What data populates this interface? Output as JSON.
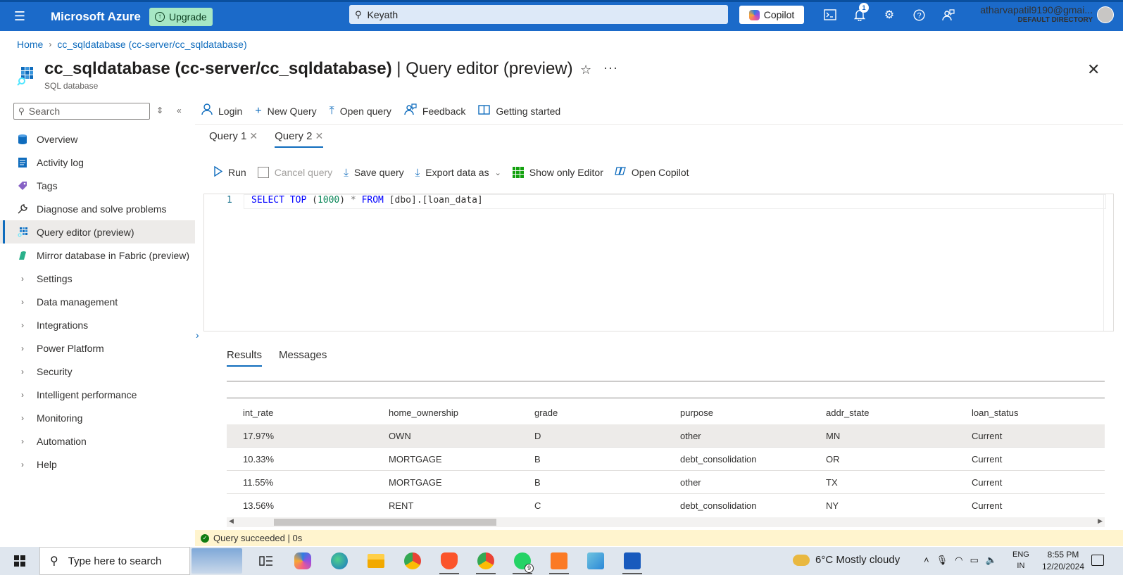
{
  "topbar": {
    "brand": "Microsoft Azure",
    "upgrade_label": "Upgrade",
    "search_value": "Keyath",
    "copilot_label": "Copilot",
    "notification_count": "1",
    "account_email": "atharvapatil9190@gmai...",
    "account_directory": "DEFAULT DIRECTORY"
  },
  "breadcrumb": {
    "home": "Home",
    "current": "cc_sqldatabase (cc-server/cc_sqldatabase)"
  },
  "header": {
    "title_resource": "cc_sqldatabase (cc-server/cc_sqldatabase)",
    "title_separator": " | ",
    "title_blade": "Query editor (preview)",
    "subtitle": "SQL database",
    "star_glyph": "☆",
    "more_glyph": "···",
    "close_glyph": "✕"
  },
  "sidebar": {
    "search_placeholder": "Search",
    "items": [
      {
        "label": "Overview",
        "icon": "sql-icon"
      },
      {
        "label": "Activity log",
        "icon": "activity-log-icon"
      },
      {
        "label": "Tags",
        "icon": "tag-icon"
      },
      {
        "label": "Diagnose and solve problems",
        "icon": "wrench-icon"
      },
      {
        "label": "Query editor (preview)",
        "icon": "query-editor-icon"
      },
      {
        "label": "Mirror database in Fabric (preview)",
        "icon": "fabric-icon"
      },
      {
        "label": "Settings",
        "icon": "chevron-right-icon"
      },
      {
        "label": "Data management",
        "icon": "chevron-right-icon"
      },
      {
        "label": "Integrations",
        "icon": "chevron-right-icon"
      },
      {
        "label": "Power Platform",
        "icon": "chevron-right-icon"
      },
      {
        "label": "Security",
        "icon": "chevron-right-icon"
      },
      {
        "label": "Intelligent performance",
        "icon": "chevron-right-icon"
      },
      {
        "label": "Monitoring",
        "icon": "chevron-right-icon"
      },
      {
        "label": "Automation",
        "icon": "chevron-right-icon"
      },
      {
        "label": "Help",
        "icon": "chevron-right-icon"
      }
    ]
  },
  "toolbar": {
    "login": "Login",
    "new_query": "New Query",
    "open_query": "Open query",
    "feedback": "Feedback",
    "getting_started": "Getting started"
  },
  "query_tabs": [
    {
      "label": "Query 1"
    },
    {
      "label": "Query 2"
    }
  ],
  "editor_toolbar": {
    "run": "Run",
    "cancel_query": "Cancel query",
    "save_query": "Save query",
    "export_data_as": "Export data as",
    "show_only_editor": "Show only Editor",
    "open_copilot": "Open Copilot"
  },
  "editor": {
    "line_number": "1",
    "code": {
      "select": "SELECT",
      "top": "TOP",
      "open_paren": " (",
      "number": "1000",
      "close_paren": ") ",
      "star": "*",
      "from": "FROM",
      "table": " [dbo].[loan_data]"
    }
  },
  "results": {
    "tabs": [
      "Results",
      "Messages"
    ],
    "columns": [
      "int_rate",
      "home_ownership",
      "grade",
      "purpose",
      "addr_state",
      "loan_status"
    ],
    "rows": [
      [
        "17.97%",
        "OWN",
        "D",
        "other",
        "MN",
        "Current"
      ],
      [
        "10.33%",
        "MORTGAGE",
        "B",
        "debt_consolidation",
        "OR",
        "Current"
      ],
      [
        "11.55%",
        "MORTGAGE",
        "B",
        "other",
        "TX",
        "Current"
      ],
      [
        "13.56%",
        "RENT",
        "C",
        "debt_consolidation",
        "NY",
        "Current"
      ]
    ],
    "status": "Query succeeded | 0s"
  },
  "taskbar": {
    "search_placeholder": "Type here to search",
    "whatsapp_badge": "9",
    "weather": "6°C  Mostly cloudy",
    "lang_1": "ENG",
    "lang_2": "IN",
    "time": "8:55 PM",
    "date": "12/20/2024"
  },
  "colors": {
    "azure_blue": "#1b6ac9",
    "accent": "#0f6cbd",
    "success": "#107c10",
    "status_bg": "#fff4ce"
  }
}
